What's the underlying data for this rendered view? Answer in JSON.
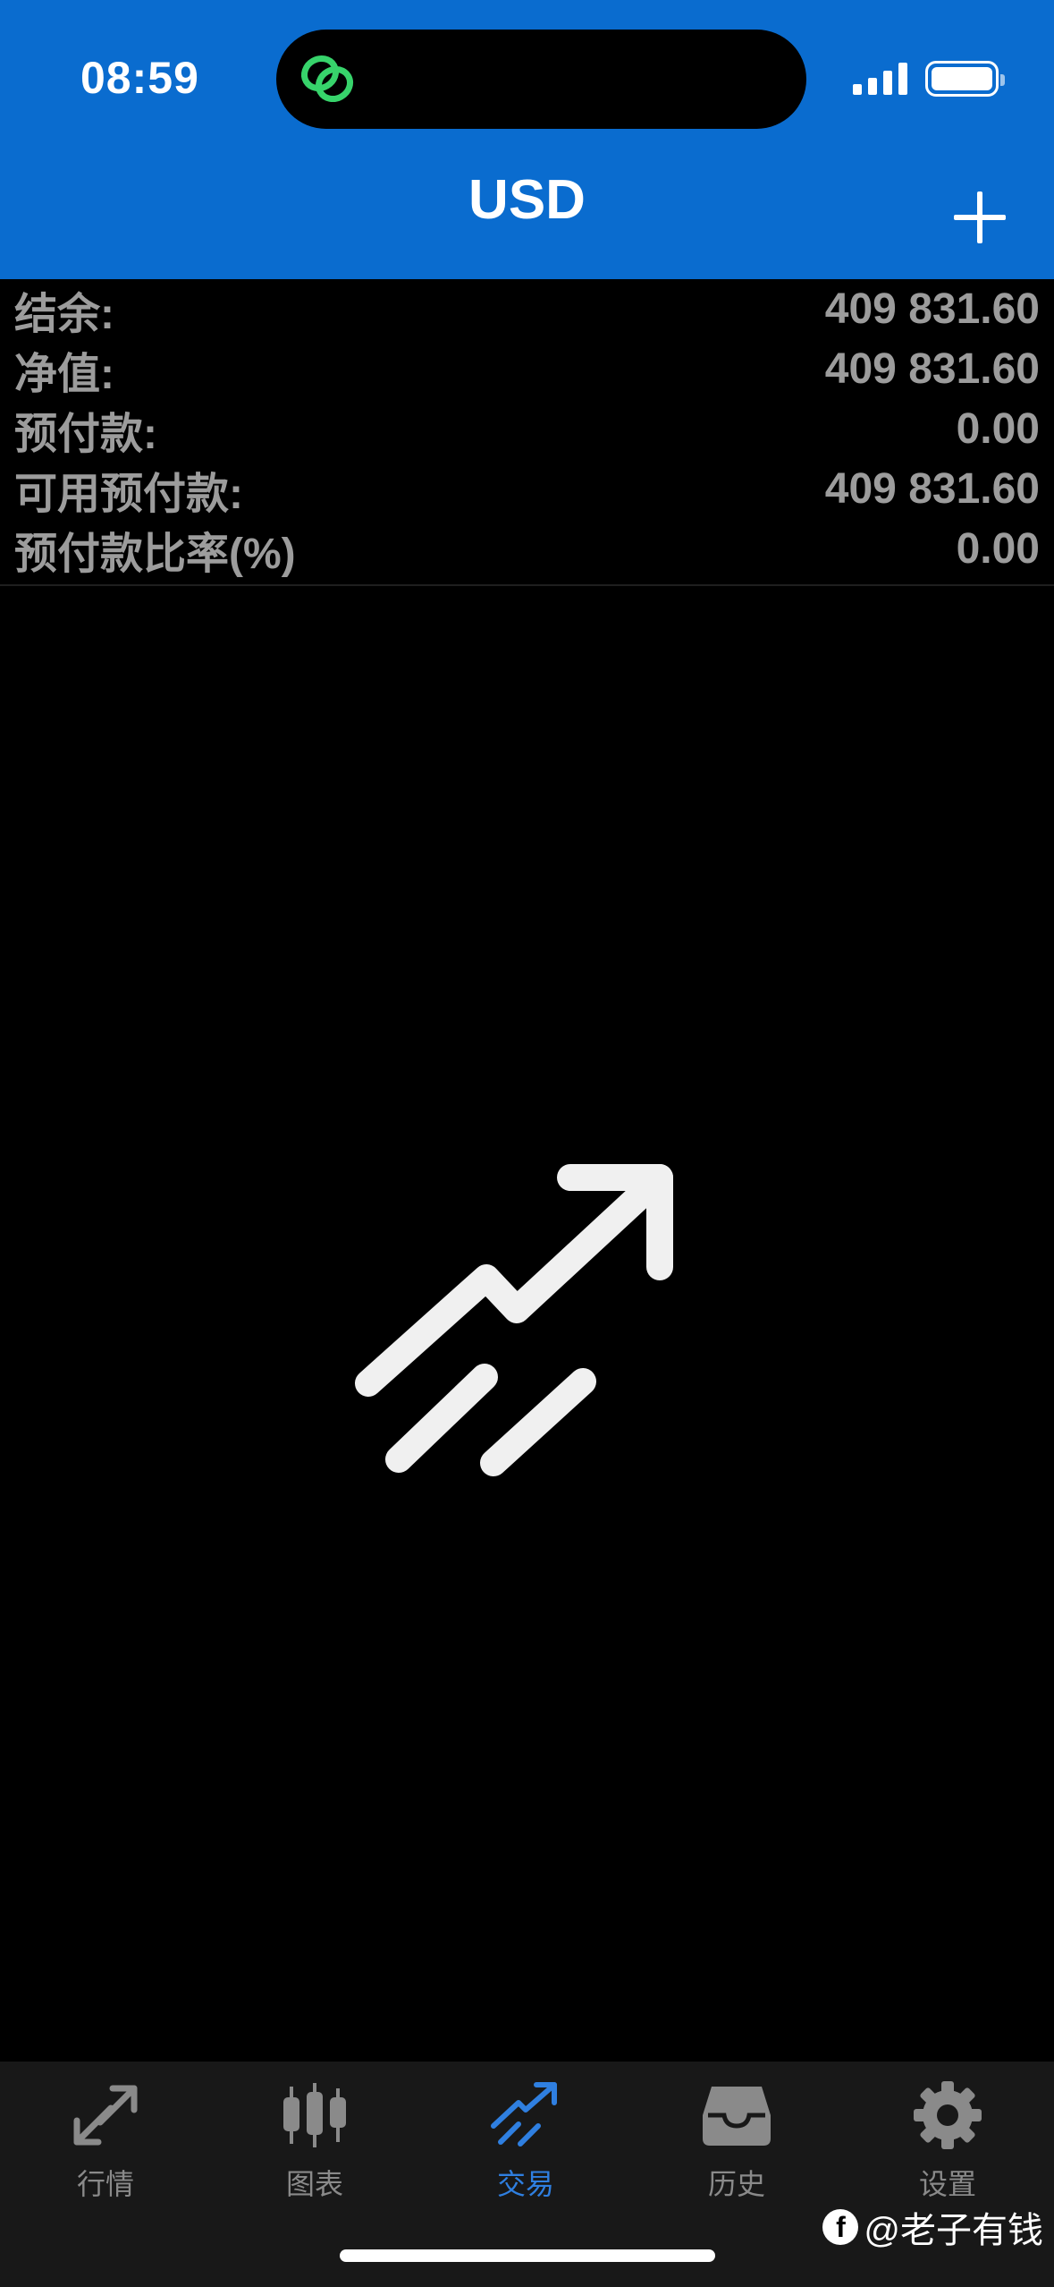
{
  "status_bar": {
    "time": "08:59",
    "signal_bars": 4,
    "battery_level": 1.0
  },
  "header": {
    "title": "USD",
    "add_icon": "plus-icon"
  },
  "account": {
    "rows": [
      {
        "label": "结余:",
        "value": "409 831.60"
      },
      {
        "label": "净值:",
        "value": "409 831.60"
      },
      {
        "label": "预付款:",
        "value": "0.00"
      },
      {
        "label": "可用预付款:",
        "value": "409 831.60"
      },
      {
        "label": "预付款比率(%)",
        "value": "0.00"
      }
    ]
  },
  "empty_state_icon": "trade-arrow-icon",
  "tabs": [
    {
      "label": "行情",
      "icon": "quotes-icon",
      "active": false
    },
    {
      "label": "图表",
      "icon": "chart-candles-icon",
      "active": false
    },
    {
      "label": "交易",
      "icon": "trade-icon",
      "active": true
    },
    {
      "label": "历史",
      "icon": "history-inbox-icon",
      "active": false
    },
    {
      "label": "设置",
      "icon": "gear-icon",
      "active": false
    }
  ],
  "watermark": {
    "text": "@老子有钱"
  },
  "colors": {
    "header_bg": "#0a6ccf",
    "active_tab": "#2f7fe0",
    "island_icon": "#37d36b"
  }
}
